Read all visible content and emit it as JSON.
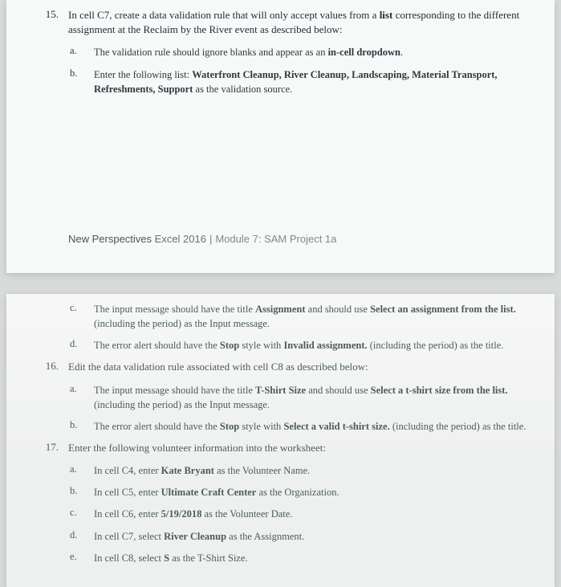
{
  "page1": {
    "q15": {
      "number": "15.",
      "text_parts": [
        "In cell C7, create a data validation rule that will only accept values from a ",
        "list",
        " corresponding to the different assignment at the Reclaim by the River event as described below:"
      ],
      "a": {
        "letter": "a.",
        "parts": [
          "The validation rule should ignore blanks and appear as an ",
          "in-cell dropdown",
          "."
        ]
      },
      "b": {
        "letter": "b.",
        "parts": [
          "Enter the following list: ",
          "Waterfront Cleanup, River Cleanup, Landscaping, Material Transport, Refreshments, Support",
          " as the validation source."
        ]
      }
    },
    "footer": {
      "title": "New Perspectives",
      "product": " Excel 2016",
      "module": "Module 7: SAM Project 1a"
    }
  },
  "page2": {
    "c": {
      "letter": "c.",
      "parts": [
        "The input message should have the title ",
        "Assignment",
        " and should use ",
        "Select an assignment from the list.",
        " (including the period) as the Input message."
      ]
    },
    "d": {
      "letter": "d.",
      "parts": [
        "The error alert should have the ",
        "Stop",
        " style with ",
        "Invalid assignment.",
        " (including the period) as the title."
      ]
    },
    "q16": {
      "number": "16.",
      "text": "Edit the data validation rule associated with cell C8 as described below:",
      "a": {
        "letter": "a.",
        "parts": [
          "The input message should have the title ",
          "T-Shirt Size",
          " and should use ",
          "Select a t-shirt size from the list.",
          " (including the period) as the Input message."
        ]
      },
      "b": {
        "letter": "b.",
        "parts": [
          "The error alert should have the ",
          "Stop",
          " style with ",
          "Select a valid t-shirt size.",
          " (including the period) as the title."
        ]
      }
    },
    "q17": {
      "number": "17.",
      "text": "Enter the following volunteer information into the worksheet:",
      "a": {
        "letter": "a.",
        "parts": [
          "In cell C4, enter ",
          "Kate Bryant",
          " as the Volunteer Name."
        ]
      },
      "b": {
        "letter": "b.",
        "parts": [
          "In cell C5, enter ",
          "Ultimate Craft Center",
          " as the Organization."
        ]
      },
      "c": {
        "letter": "c.",
        "parts": [
          "In cell C6, enter ",
          "5/19/2018",
          " as the Volunteer Date."
        ]
      },
      "d": {
        "letter": "d.",
        "parts": [
          "In cell C7, select ",
          "River Cleanup",
          " as the Assignment."
        ]
      },
      "e": {
        "letter": "e.",
        "parts": [
          "In cell C8, select ",
          "S",
          " as the T-Shirt Size."
        ]
      }
    }
  }
}
